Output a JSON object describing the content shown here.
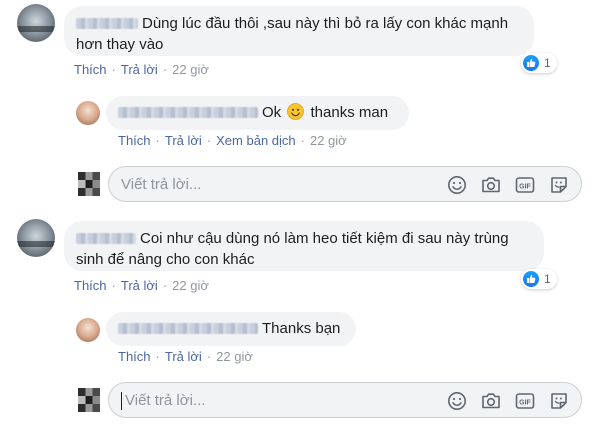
{
  "comments": [
    {
      "text": "Dùng lúc đầu thôi ,sau này thì bỏ ra lấy con khác mạnh hơn thay vào",
      "line1": "Dùng lúc đầu thôi ,sau này thì bỏ ra lấy con khác mạnh",
      "line2": "hơn thay vào",
      "actions": {
        "like": "Thích",
        "reply": "Trả lời",
        "time": "22 giờ"
      },
      "reaction_count": "1",
      "reply": {
        "text_before": "Ok",
        "text_after": "thanks man",
        "actions": {
          "like": "Thích",
          "reply": "Trả lời",
          "translate": "Xem bản dịch",
          "time": "22 giờ"
        }
      },
      "reply_box_placeholder": "Viết trả lời..."
    },
    {
      "text": "Coi như cậu dùng nó làm heo tiết kiệm đi sau này trùng sinh để nâng cho con khác",
      "line1": "Coi như cậu dùng nó làm heo tiết kiệm đi sau này trùng",
      "line2": "sinh để nâng cho con khác",
      "actions": {
        "like": "Thích",
        "reply": "Trả lời",
        "time": "22 giờ"
      },
      "reaction_count": "1",
      "reply": {
        "text": "Thanks bạn",
        "actions": {
          "like": "Thích",
          "reply": "Trả lời",
          "time": "22 giờ"
        }
      },
      "reply_box_placeholder": "Viết trả lời..."
    }
  ],
  "colors": {
    "link": "#4b67a1",
    "meta": "#9097a0",
    "bubble": "#f2f3f5",
    "like_blue": "#1877f2"
  },
  "icons": [
    "emoji-icon",
    "camera-icon",
    "gif-icon",
    "sticker-icon",
    "like-icon",
    "smiley-emoji-icon"
  ]
}
